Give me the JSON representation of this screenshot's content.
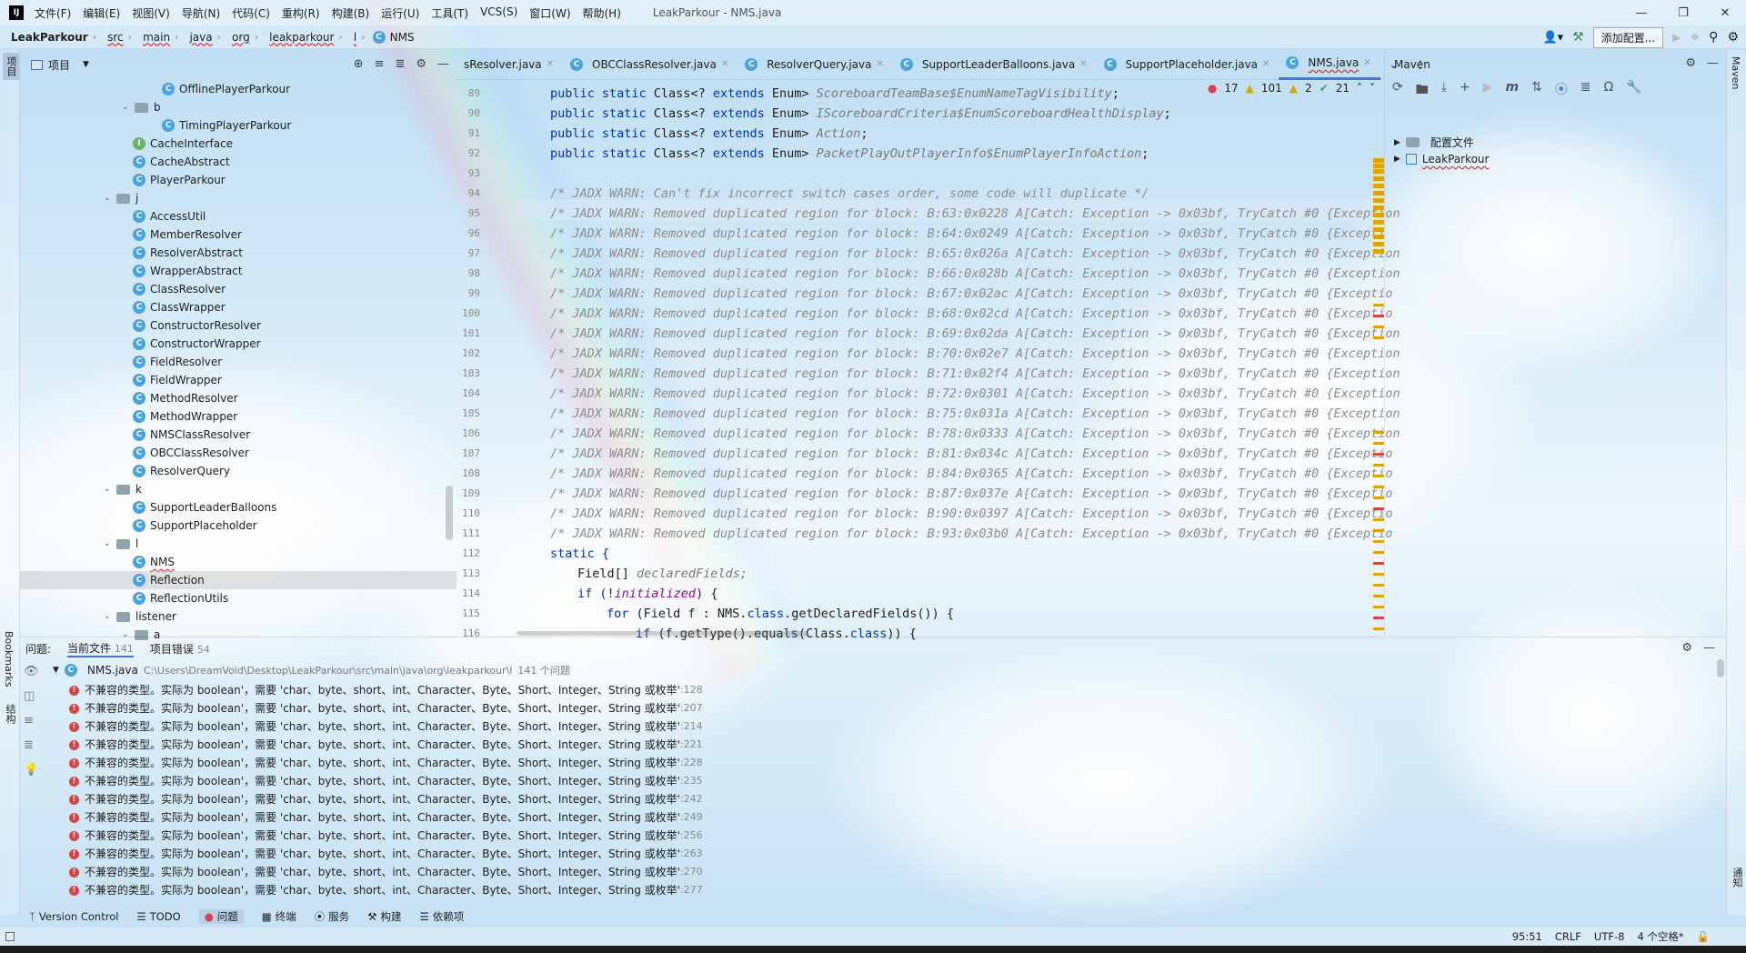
{
  "window": {
    "title": "LeakParkour - NMS.java",
    "menu": [
      "文件(F)",
      "编辑(E)",
      "视图(V)",
      "导航(N)",
      "代码(C)",
      "重构(R)",
      "构建(B)",
      "运行(U)",
      "工具(T)",
      "VCS(S)",
      "窗口(W)",
      "帮助(H)"
    ]
  },
  "breadcrumb": [
    "LeakParkour",
    "src",
    "main",
    "java",
    "org",
    "leakparkour",
    "l",
    "NMS"
  ],
  "toolbar": {
    "run_config": "添加配置..."
  },
  "stripes": {
    "left_top": "项目",
    "left_bottom_1": "Bookmarks",
    "left_bottom_2": "结构",
    "right_top": "Maven",
    "right_bottom": "通知"
  },
  "project_panel": {
    "title": "项目",
    "tree": [
      {
        "label": "OfflinePlayerParkour",
        "type": "class"
      },
      {
        "label": "b",
        "type": "folder"
      },
      {
        "label": "TimingPlayerParkour",
        "type": "class"
      },
      {
        "label": "CacheInterface",
        "type": "interface"
      },
      {
        "label": "CacheAbstract",
        "type": "class"
      },
      {
        "label": "PlayerParkour",
        "type": "class"
      },
      {
        "label": "j",
        "type": "folder"
      },
      {
        "label": "AccessUtil",
        "type": "class"
      },
      {
        "label": "MemberResolver",
        "type": "class"
      },
      {
        "label": "ResolverAbstract",
        "type": "class"
      },
      {
        "label": "WrapperAbstract",
        "type": "class"
      },
      {
        "label": "ClassResolver",
        "type": "class"
      },
      {
        "label": "ClassWrapper",
        "type": "class"
      },
      {
        "label": "ConstructorResolver",
        "type": "class"
      },
      {
        "label": "ConstructorWrapper",
        "type": "class"
      },
      {
        "label": "FieldResolver",
        "type": "class"
      },
      {
        "label": "FieldWrapper",
        "type": "class"
      },
      {
        "label": "MethodResolver",
        "type": "class"
      },
      {
        "label": "MethodWrapper",
        "type": "class"
      },
      {
        "label": "NMSClassResolver",
        "type": "class"
      },
      {
        "label": "OBCClassResolver",
        "type": "class"
      },
      {
        "label": "ResolverQuery",
        "type": "class"
      },
      {
        "label": "k",
        "type": "folder"
      },
      {
        "label": "SupportLeaderBalloons",
        "type": "class"
      },
      {
        "label": "SupportPlaceholder",
        "type": "class"
      },
      {
        "label": "l",
        "type": "folder"
      },
      {
        "label": "NMS",
        "type": "class"
      },
      {
        "label": "Reflection",
        "type": "class"
      },
      {
        "label": "ReflectionUtils",
        "type": "class"
      },
      {
        "label": "listener",
        "type": "folder"
      },
      {
        "label": "a",
        "type": "folder"
      }
    ]
  },
  "editor": {
    "tabs": [
      "sResolver.java",
      "OBCClassResolver.java",
      "ResolverQuery.java",
      "SupportLeaderBalloons.java",
      "SupportPlaceholder.java",
      "NMS.java"
    ],
    "inspections": {
      "errors": "17",
      "warnings": "101",
      "weak_warnings": "2",
      "ok": "21"
    },
    "line_numbers": [
      "89",
      "90",
      "91",
      "92",
      "93",
      "94",
      "95",
      "96",
      "97",
      "98",
      "99",
      "100",
      "101",
      "102",
      "103",
      "104",
      "105",
      "106",
      "107",
      "108",
      "109",
      "110",
      "111",
      "112",
      "113",
      "114",
      "115",
      "116"
    ],
    "enum_lines": [
      {
        "pre": "public static ",
        "kw": "Class",
        "mid": "<? ",
        "kw2": "extends",
        "type": " Enum> ",
        "name": "ScoreboardTeamBase$EnumNameTagVisibility",
        "end": ";"
      },
      {
        "pre": "public static ",
        "kw": "Class",
        "mid": "<? ",
        "kw2": "extends",
        "type": " Enum> ",
        "name": "IScoreboardCriteria$EnumScoreboardHealthDisplay",
        "end": ";"
      },
      {
        "pre": "public static ",
        "kw": "Class",
        "mid": "<? ",
        "kw2": "extends",
        "type": " Enum> ",
        "name": "Action",
        "end": ";"
      },
      {
        "pre": "public static ",
        "kw": "Class",
        "mid": "<? ",
        "kw2": "extends",
        "type": " Enum> ",
        "name": "PacketPlayOutPlayerInfo$EnumPlayerInfoAction",
        "end": ";"
      }
    ],
    "warn_lines": [
      "/* JADX WARN: Can't fix incorrect switch cases order, some code will duplicate */",
      "/* JADX WARN: Removed duplicated region for block: B:63:0x0228 A[Catch: Exception -> 0x03bf, TryCatch #0 {Exception",
      "/* JADX WARN: Removed duplicated region for block: B:64:0x0249 A[Catch: Exception -> 0x03bf, TryCatch #0 {Excepti",
      "/* JADX WARN: Removed duplicated region for block: B:65:0x026a A[Catch: Exception -> 0x03bf, TryCatch #0 {Exception",
      "/* JADX WARN: Removed duplicated region for block: B:66:0x028b A[Catch: Exception -> 0x03bf, TryCatch #0 {Exception",
      "/* JADX WARN: Removed duplicated region for block: B:67:0x02ac A[Catch: Exception -> 0x03bf, TryCatch #0 {Exceptio",
      "/* JADX WARN: Removed duplicated region for block: B:68:0x02cd A[Catch: Exception -> 0x03bf, TryCatch #0 {Exceptio",
      "/* JADX WARN: Removed duplicated region for block: B:69:0x02da A[Catch: Exception -> 0x03bf, TryCatch #0 {Exception",
      "/* JADX WARN: Removed duplicated region for block: B:70:0x02e7 A[Catch: Exception -> 0x03bf, TryCatch #0 {Exception",
      "/* JADX WARN: Removed duplicated region for block: B:71:0x02f4 A[Catch: Exception -> 0x03bf, TryCatch #0 {Exception",
      "/* JADX WARN: Removed duplicated region for block: B:72:0x0301 A[Catch: Exception -> 0x03bf, TryCatch #0 {Exception",
      "/* JADX WARN: Removed duplicated region for block: B:75:0x031a A[Catch: Exception -> 0x03bf, TryCatch #0 {Exception",
      "/* JADX WARN: Removed duplicated region for block: B:78:0x0333 A[Catch: Exception -> 0x03bf, TryCatch #0 {Exception",
      "/* JADX WARN: Removed duplicated region for block: B:81:0x034c A[Catch: Exception -> 0x03bf, TryCatch #0 {Exceptio",
      "/* JADX WARN: Removed duplicated region for block: B:84:0x0365 A[Catch: Exception -> 0x03bf, TryCatch #0 {Exceptio",
      "/* JADX WARN: Removed duplicated region for block: B:87:0x037e A[Catch: Exception -> 0x03bf, TryCatch #0 {Exceptio",
      "/* JADX WARN: Removed duplicated region for block: B:90:0x0397 A[Catch: Exception -> 0x03bf, TryCatch #0 {Exceptio",
      "/* JADX WARN: Removed duplicated region for block: B:93:0x03b0 A[Catch: Exception -> 0x03bf, TryCatch #0 {Exceptio"
    ],
    "code_tail": {
      "l112": "static {",
      "l113_type": "Field[] ",
      "l113_var": "declaredFields;",
      "l114_kw": "if (",
      "l114_bang": "!",
      "l114_field": "initialized",
      "l114_end": ") {",
      "l115_kw": "for ",
      "l115_rest": "(Field f : NMS.",
      "l115_cls": "class",
      "l115_end": ".getDeclaredFields()) {",
      "l116_kw": "if ",
      "l116_rest": "(f.getType().equals(Class.",
      "l116_cls": "class",
      "l116_end": ")) {"
    }
  },
  "maven": {
    "title": "Maven",
    "items": [
      "配置文件",
      "LeakParkour"
    ]
  },
  "problems": {
    "title": "问题:",
    "tabs": [
      {
        "label": "当前文件",
        "count": "141"
      },
      {
        "label": "项目错误",
        "count": "54"
      }
    ],
    "file": "NMS.java",
    "file_path": "C:\\Users\\DreamVoid\\Desktop\\LeakParkour\\src\\main\\java\\org\\leakparkour\\l",
    "file_count": "141 个问题",
    "message": "不兼容的类型。实际为 boolean'，需要 'char、byte、short、int、Character、Byte、Short、Integer、String 或枚举'",
    "rows": [
      ":128",
      ":207",
      ":214",
      ":221",
      ":228",
      ":235",
      ":242",
      ":249",
      ":256",
      ":263",
      ":270",
      ":277"
    ]
  },
  "tool_windows": [
    "Version Control",
    "TODO",
    "问题",
    "终端",
    "服务",
    "构建",
    "依赖项"
  ],
  "status": {
    "position": "95:51",
    "line_sep": "CRLF",
    "encoding": "UTF-8",
    "indent": "4 个空格*"
  }
}
